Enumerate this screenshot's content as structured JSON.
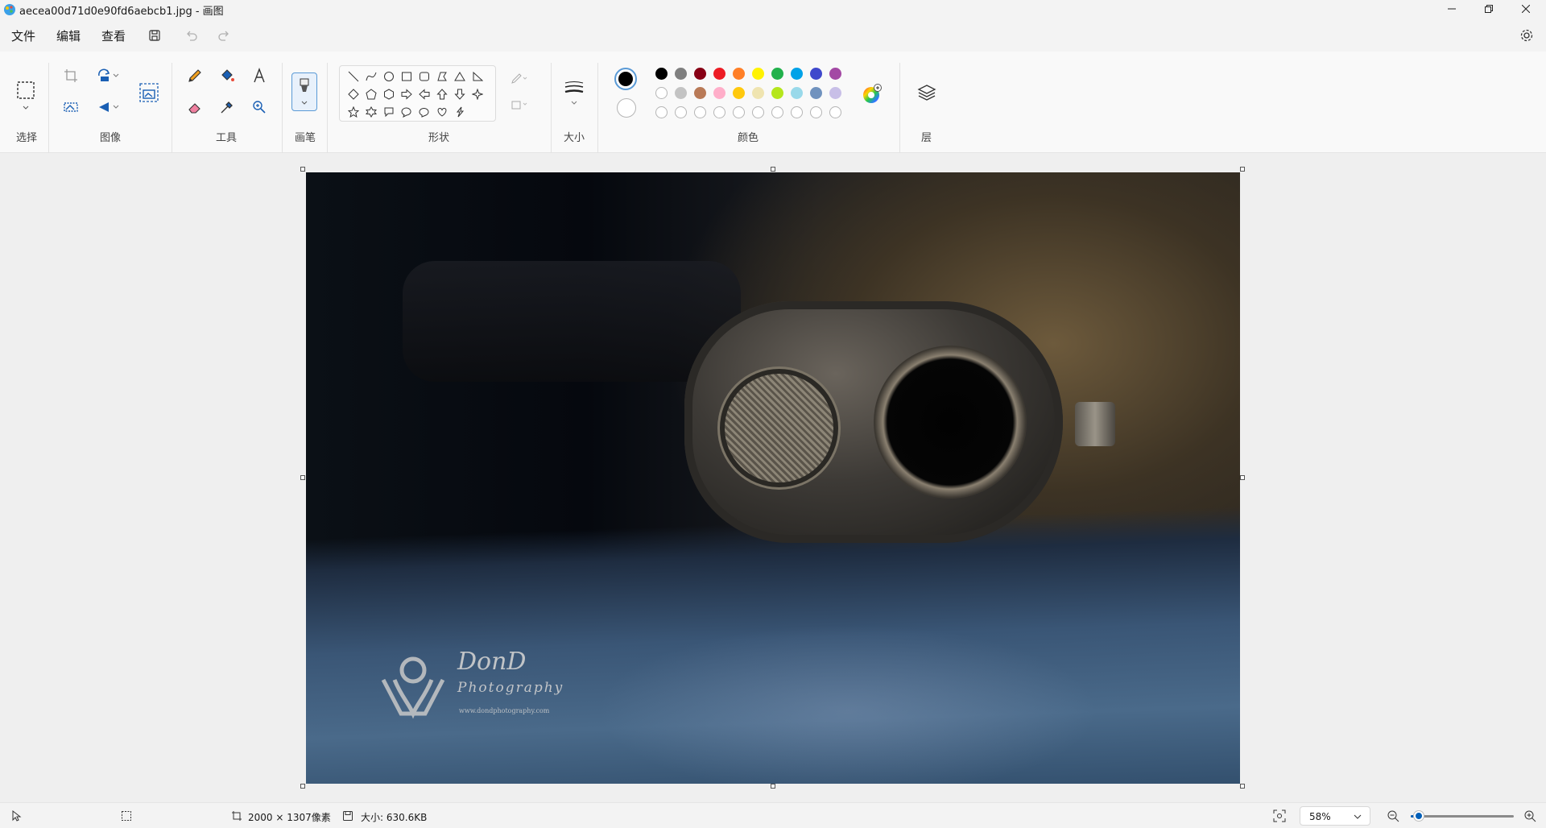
{
  "window": {
    "title": "aecea00d71d0e90fd6aebcb1.jpg - 画图",
    "controls": [
      "minimize-icon",
      "restore-icon",
      "close-icon"
    ]
  },
  "menu": {
    "items": [
      "文件",
      "编辑",
      "查看"
    ],
    "quick_actions": [
      "save-icon",
      "undo-icon",
      "redo-icon"
    ]
  },
  "ribbon": {
    "groups": {
      "select": "选择",
      "image": "图像",
      "tools": "工具",
      "brush": "画笔",
      "shapes": "形状",
      "size": "大小",
      "colors": "颜色",
      "layers": "层"
    },
    "colors": {
      "primary": "#000000",
      "secondary": "#ffffff",
      "row1": [
        "#000000",
        "#7f7f7f",
        "#880015",
        "#ed1c24",
        "#ff7f27",
        "#fff200",
        "#22b14c",
        "#00a2e8",
        "#3f48cc",
        "#a349a4"
      ],
      "row2": [
        "#ffffff",
        "#c3c3c3",
        "#b97a57",
        "#ffaec9",
        "#ffc90e",
        "#efe4b0",
        "#b5e61d",
        "#99d9ea",
        "#7092be",
        "#c8bfe7"
      ],
      "row3_custom_count": 10
    }
  },
  "canvas": {
    "watermark_name": "DonD",
    "watermark_sub": "Photography",
    "watermark_url": "www.dondphotography.com"
  },
  "status": {
    "dimensions": "2000 × 1307像素",
    "size": "大小: 630.6KB",
    "zoom": "58%",
    "zoom_fraction": 0.08
  }
}
